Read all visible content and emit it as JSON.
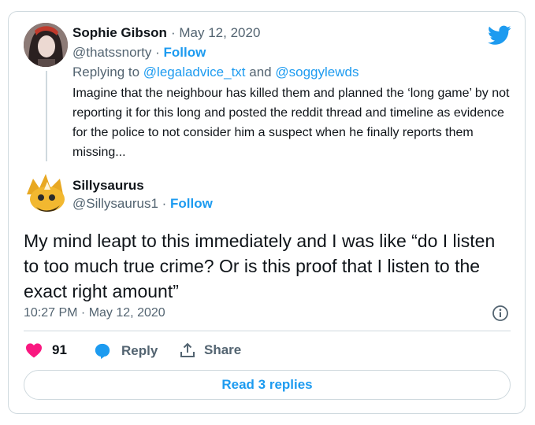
{
  "reply_tweet": {
    "author_name": "Sophie Gibson",
    "date": "May 12, 2020",
    "handle": "@thatssnorty",
    "follow_label": "Follow",
    "replying_prefix": "Replying to",
    "replying_user1": "@legaladvice_txt",
    "replying_and": "and",
    "replying_user2": "@soggylewds",
    "text": "Imagine that the neighbour has killed them and planned the ‘long game’ by not reporting it for this long and posted the reddit thread and timeline as evidence for the police to not consider him a suspect when he finally reports them missing..."
  },
  "main_tweet": {
    "author_name": "Sillysaurus",
    "handle": "@Sillysaurus1",
    "follow_label": "Follow",
    "text": "My mind leapt to this immediately and I was like “do I listen to too much true crime? Or is this proof that I listen to the exact right amount”",
    "timestamp": "10:27 PM · May 12, 2020"
  },
  "actions": {
    "likes_count": "91",
    "reply_label": "Reply",
    "share_label": "Share"
  },
  "read_replies_label": "Read 3 replies",
  "colors": {
    "accent": "#1d9bf0",
    "like": "#f91880",
    "muted": "#536471",
    "border": "#cfd9de"
  },
  "icons": [
    "twitter-bird-icon",
    "info-icon",
    "heart-icon",
    "reply-bubble-icon",
    "share-icon"
  ]
}
